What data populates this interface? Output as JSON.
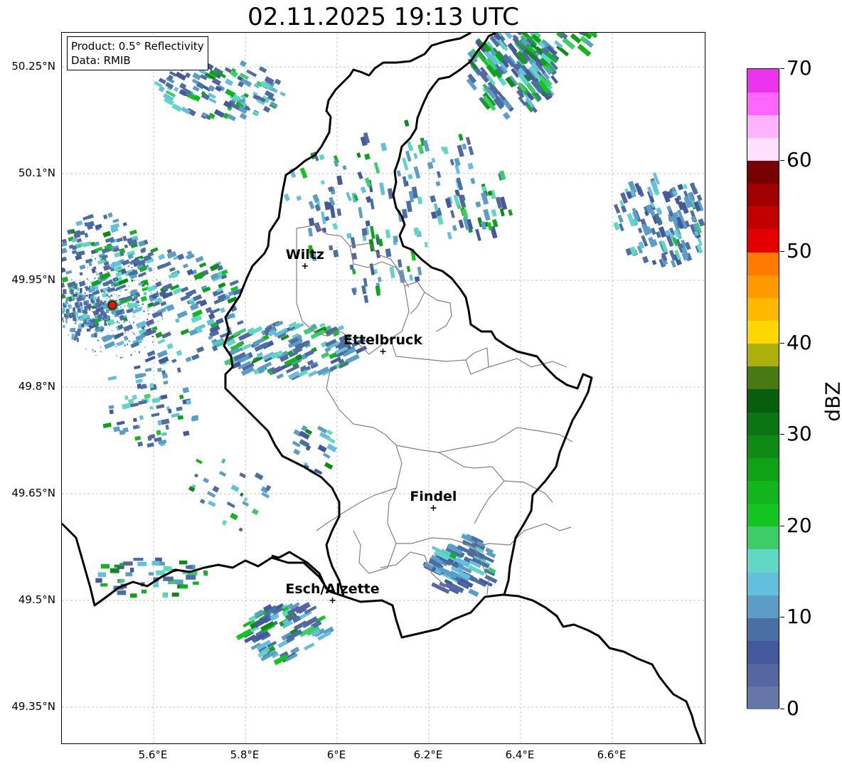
{
  "title": "02.11.2025 19:13 UTC",
  "info": {
    "product": "Product: 0.5° Reflectivity",
    "data": "Data: RMIB"
  },
  "lat_labels": [
    "50.25°N",
    "50.1°N",
    "49.95°N",
    "49.8°N",
    "49.65°N",
    "49.5°N",
    "49.35°N"
  ],
  "lon_labels": [
    "5.6°E",
    "5.8°E",
    "6°E",
    "6.2°E",
    "6.4°E",
    "6.6°E"
  ],
  "cities": [
    {
      "name": "Wiltz",
      "lon": 5.93,
      "lat": 49.97
    },
    {
      "name": "Ettelbruck",
      "lon": 6.1,
      "lat": 49.85
    },
    {
      "name": "Findel",
      "lon": 6.21,
      "lat": 49.63
    },
    {
      "name": "Esch/Alzette",
      "lon": 5.99,
      "lat": 49.5
    }
  ],
  "radar_site": {
    "lon": 5.51,
    "lat": 49.915
  },
  "colorbar": {
    "label": "dBZ",
    "min": 0,
    "max": 70,
    "step": 2.5,
    "tick_labels": [
      "0",
      "10",
      "20",
      "30",
      "40",
      "50",
      "60",
      "70"
    ],
    "colors": [
      "#6677a7",
      "#5566a1",
      "#44599b",
      "#4a6fa5",
      "#5b9dc6",
      "#64bfdc",
      "#60d6c5",
      "#3ccd6a",
      "#13c61f",
      "#13b51c",
      "#0fa215",
      "#0e8b14",
      "#0a7512",
      "#075e0d",
      "#477a12",
      "#adaf0b",
      "#ffd700",
      "#ffb800",
      "#ff9900",
      "#ff7b00",
      "#e30000",
      "#c20000",
      "#a00000",
      "#780000",
      "#ffe0ff",
      "#ffb3ff",
      "#ff66ff",
      "#ee33ee"
    ]
  }
}
